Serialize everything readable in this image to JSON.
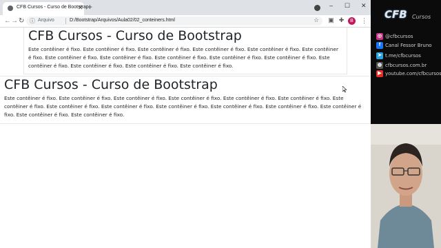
{
  "browser": {
    "tab": {
      "title": "CFB Cursos - Curso de Bootstrap",
      "close": "✕"
    },
    "newtab": "+",
    "window_controls": {
      "minimize": "–",
      "maximize": "☐",
      "close": "✕"
    },
    "nav": {
      "back": "←",
      "forward": "→",
      "reload": "↻"
    },
    "address": {
      "info": "ⓘ",
      "scheme": "Arquivo",
      "url": "D:/Bootstrap/Arquivos/Aula02/02_conteiners.html",
      "star": "☆"
    },
    "profile": "B",
    "menu": "⋮"
  },
  "page": {
    "fixed_container": {
      "heading": "CFB Cursos - Curso de Bootstrap",
      "text": "Este contêiner é fixo. Este contêiner é fixo. Este contêiner é fixo. Este contêiner é fixo. Este contêiner é fixo. Este contêiner é fixo. Este contêiner é fixo. Este contêiner é fixo. Este contêiner é fixo. Este contêiner é fixo. Este contêiner é fixo. Este contêiner é fixo. Este contêiner é fixo. Este contêiner é fixo. Este contêiner é fixo."
    },
    "fluid_container": {
      "heading": "CFB Cursos - Curso de Bootstrap",
      "text": "Este contêiner é fixo. Este contêiner é fixo. Este contêiner é fixo. Este contêiner é fixo. Este contêiner é fixo. Este contêiner é fixo. Este contêiner é fixo. Este contêiner é fixo. Este contêiner é fixo. Este contêiner é fixo. Este contêiner é fixo. Este contêiner é fixo. Este contêiner é fixo. Este contêiner é fixo. Este contêiner é fixo."
    }
  },
  "side": {
    "logo_text": "CFB",
    "logo_sub": "Cursos",
    "social": [
      {
        "icon": "instagram-icon",
        "color": "#c13584",
        "glyph": "◎",
        "label": "@cfbcursos"
      },
      {
        "icon": "facebook-icon",
        "color": "#1877f2",
        "glyph": "f",
        "label": "Canal Fessor Bruno"
      },
      {
        "icon": "telegram-icon",
        "color": "#2aa3df",
        "glyph": "➤",
        "label": "t.me/cfbcursos"
      },
      {
        "icon": "web-icon",
        "color": "#555555",
        "glyph": "◍",
        "label": "cfbcursos.com.br"
      },
      {
        "icon": "youtube-icon",
        "color": "#e52d27",
        "glyph": "▶",
        "label": "youtube.com/cfbcursos"
      }
    ]
  }
}
